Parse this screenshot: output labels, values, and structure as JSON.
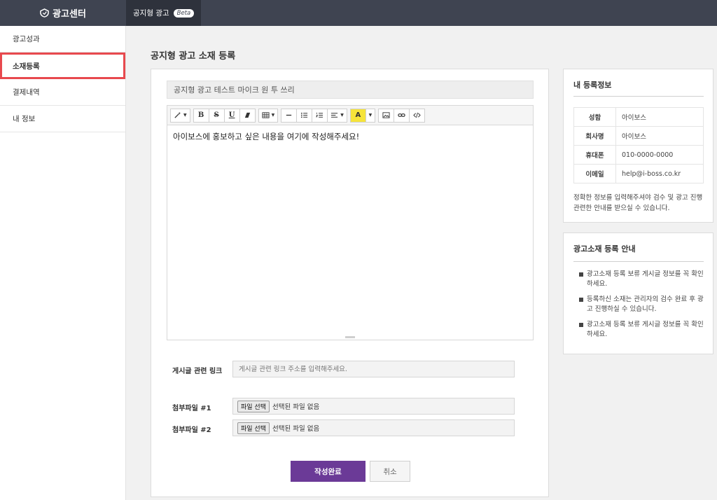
{
  "header": {
    "brand": "광고센터",
    "active_tab": "공지형 광고",
    "badge": "Beta"
  },
  "sidebar": {
    "items": [
      {
        "label": "광고성과"
      },
      {
        "label": "소재등록"
      },
      {
        "label": "결제내역"
      },
      {
        "label": "내 정보"
      }
    ]
  },
  "main": {
    "title": "공지형 광고 소재 등록",
    "ad_title_value": "공지형 광고 테스트 마이크 원 투 쓰리",
    "editor_content": "아이보스에 홍보하고 싶은 내용을 여기에 작성해주세요!",
    "link_label": "게시글 관련 링크",
    "link_placeholder": "게시글 관련 링크 주소를 입력해주세요.",
    "file1_label": "첨부파일 #1",
    "file2_label": "첨부파일 #2",
    "file_button": "파일 선택",
    "file_none": "선택된 파일 없음",
    "submit_label": "작성완료",
    "cancel_label": "취소"
  },
  "info_card": {
    "title": "내 등록정보",
    "rows": [
      {
        "key": "성함",
        "value": "아이보스"
      },
      {
        "key": "회사명",
        "value": "아이보스"
      },
      {
        "key": "휴대폰",
        "value": "010-0000-0000"
      },
      {
        "key": "이메일",
        "value": "help@i-boss.co.kr"
      }
    ],
    "note": "정확한 정보를 입력해주셔야 검수 및 광고 진행 관련한 안내를 받으실 수 있습니다."
  },
  "guide_card": {
    "title": "광고소재 등록 안내",
    "items": [
      "광고소재 등록 보류 게시글 정보를 꼭 확인하세요.",
      "등록하신 소재는 관리자의 검수 완료 후 광고 진행하실 수 있습니다.",
      "광고소재 등록 보류 게시글 정보를 꼭 확인하세요."
    ]
  },
  "colors": {
    "header_bg": "#3f4451",
    "accent_purple": "#6b3a97",
    "active_outline": "#e8494e"
  }
}
